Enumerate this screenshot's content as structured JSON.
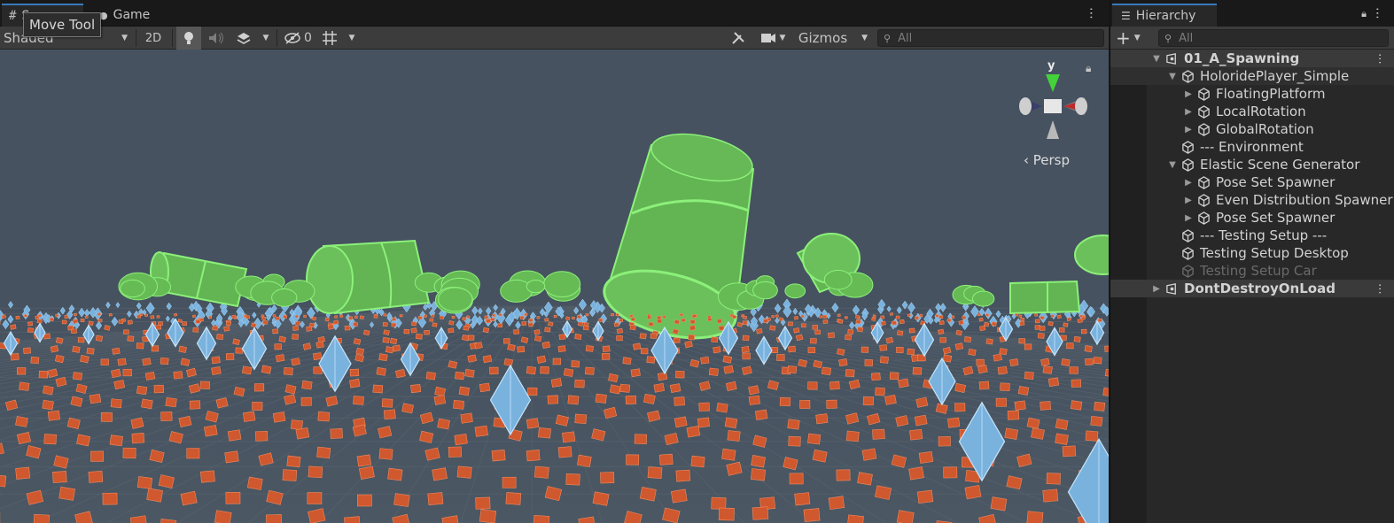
{
  "scene_view": {
    "tabs": [
      {
        "label": "Scene",
        "icon": "grid-icon"
      },
      {
        "label": "Game",
        "icon": "game-controller-icon"
      }
    ],
    "tooltip": "Move Tool",
    "toolbar": {
      "shading_mode": "Shaded",
      "two_d_label": "2D",
      "hidden_count": "0",
      "gizmos_label": "Gizmos",
      "search_placeholder": "All"
    },
    "gizmo": {
      "projection_label": "‹ Persp",
      "axis_y_label": "y"
    },
    "colors": {
      "viewport_bg": "#465260",
      "cylinder_fill": "#66bb55",
      "cube_fill": "#d0582e",
      "diamond_fill": "#7ab2de",
      "accent": "#3a79bb"
    }
  },
  "hierarchy": {
    "title": "Hierarchy",
    "search_placeholder": "All",
    "items": [
      {
        "label": "01_A_Spawning",
        "depth": 0,
        "type": "scene",
        "expanded": true
      },
      {
        "label": "HoloridePlayer_Simple",
        "depth": 1,
        "type": "object",
        "expanded": true,
        "highlighted": true
      },
      {
        "label": "FloatingPlatform",
        "depth": 2,
        "type": "object",
        "expanded": false
      },
      {
        "label": "LocalRotation",
        "depth": 2,
        "type": "object",
        "expanded": false
      },
      {
        "label": "GlobalRotation",
        "depth": 2,
        "type": "object",
        "expanded": false
      },
      {
        "label": "--- Environment",
        "depth": 1,
        "type": "object",
        "leaf": true
      },
      {
        "label": "Elastic Scene Generator",
        "depth": 1,
        "type": "object",
        "expanded": true
      },
      {
        "label": "Pose Set Spawner",
        "depth": 2,
        "type": "object",
        "expanded": false
      },
      {
        "label": "Even Distribution Spawner",
        "depth": 2,
        "type": "object",
        "expanded": false
      },
      {
        "label": "Pose Set Spawner",
        "depth": 2,
        "type": "object",
        "expanded": false
      },
      {
        "label": "--- Testing Setup ---",
        "depth": 1,
        "type": "object",
        "leaf": true
      },
      {
        "label": "Testing Setup Desktop",
        "depth": 1,
        "type": "object",
        "leaf": true
      },
      {
        "label": "Testing Setup Car",
        "depth": 1,
        "type": "object",
        "leaf": true,
        "disabled": true
      },
      {
        "label": "DontDestroyOnLoad",
        "depth": 0,
        "type": "scene",
        "expanded": false
      }
    ]
  }
}
